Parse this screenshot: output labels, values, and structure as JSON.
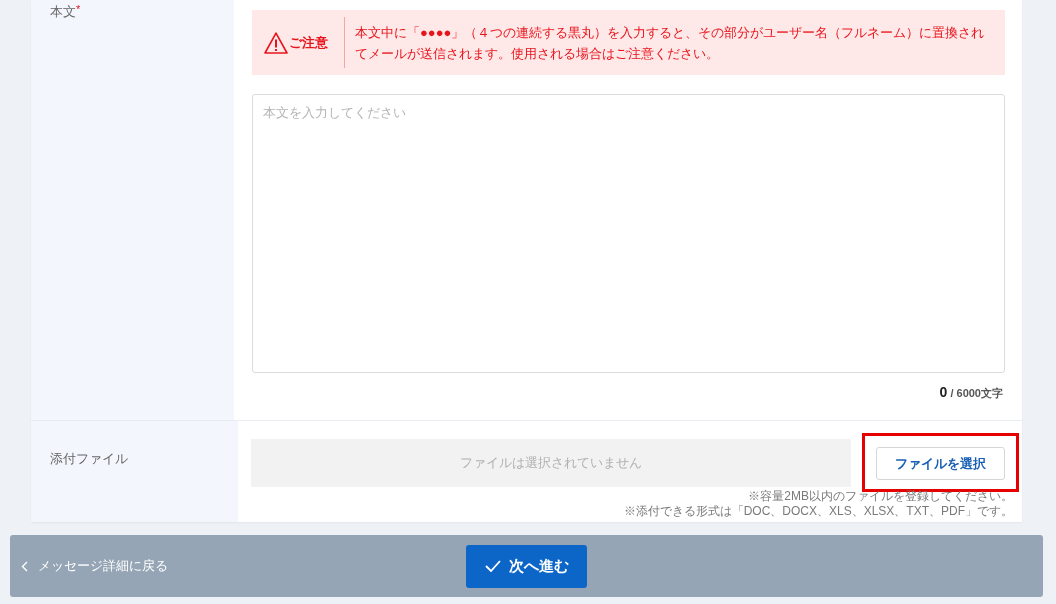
{
  "body_field": {
    "label": "本文",
    "required_mark": "*",
    "notice": {
      "title": "ご注意",
      "text": "本文中に「●●●●」（４つの連続する黒丸）を入力すると、その部分がユーザー名（フルネーム）に置換されてメールが送信されます。使用される場合はご注意ください。"
    },
    "textarea": {
      "placeholder": "本文を入力してください"
    },
    "counter": {
      "count": "0",
      "limit": "/ 6000文字"
    }
  },
  "attachment": {
    "label": "添付ファイル",
    "file_status": "ファイルは選択されていません",
    "choose_button": {
      "label": "ファイルを選択",
      "highlighted": true
    },
    "notes": [
      "※容量2MB以内のファイルを登録してください。",
      "※添付できる形式は「DOC、DOCX、XLS、XLSX、TXT、PDF」です。"
    ]
  },
  "footer": {
    "back_link": {
      "label": "メッセージ詳細に戻る"
    },
    "next_button": {
      "label": "次へ進む"
    }
  }
}
